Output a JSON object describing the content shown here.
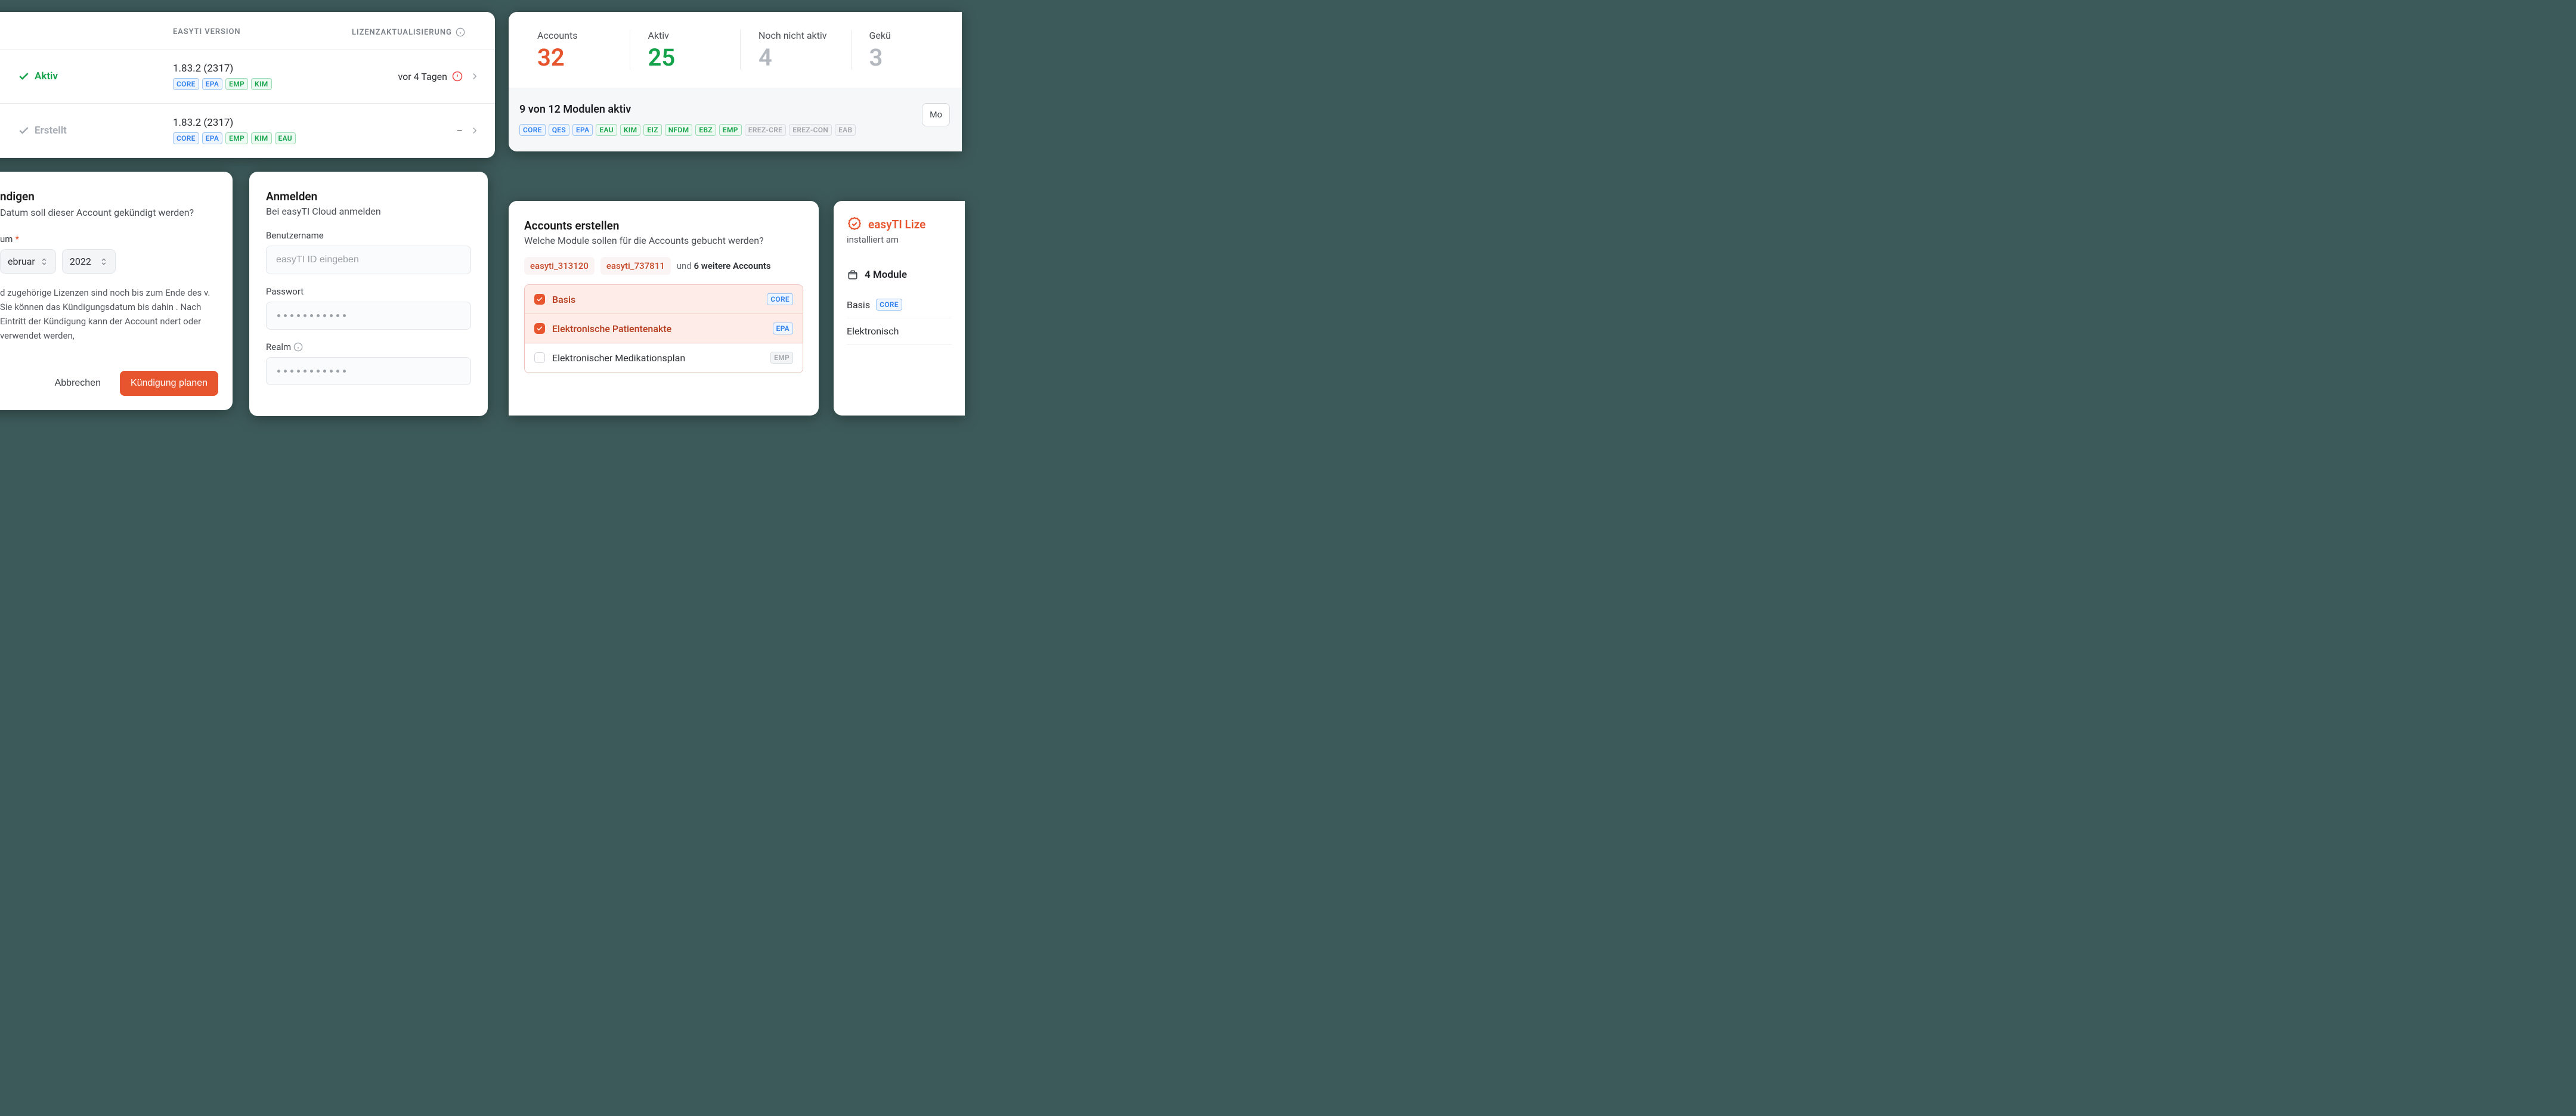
{
  "version_table": {
    "headers": {
      "version": "EASYTI VERSION",
      "license": "LIZENZAKTUALISIERUNG"
    },
    "rows": [
      {
        "status_label": "Aktiv",
        "status_state": "active",
        "version": "1.83.2 (2317)",
        "badges": [
          [
            "CORE",
            "blue"
          ],
          [
            "EPA",
            "blue"
          ],
          [
            "EMP",
            "green"
          ],
          [
            "KIM",
            "green"
          ]
        ],
        "license_text": "vor 4 Tagen",
        "license_warn": true,
        "license_dash": false
      },
      {
        "status_label": "Erstellt",
        "status_state": "idle",
        "version": "1.83.2 (2317)",
        "badges": [
          [
            "CORE",
            "blue"
          ],
          [
            "EPA",
            "blue"
          ],
          [
            "EMP",
            "green"
          ],
          [
            "KIM",
            "green"
          ],
          [
            "EAU",
            "green"
          ]
        ],
        "license_text": "–",
        "license_warn": false,
        "license_dash": true
      }
    ]
  },
  "stats": {
    "items": [
      {
        "label": "Accounts",
        "value": "32",
        "tone": "red"
      },
      {
        "label": "Aktiv",
        "value": "25",
        "tone": "green"
      },
      {
        "label": "Noch nicht aktiv",
        "value": "4",
        "tone": "gray"
      },
      {
        "label": "Gekü",
        "value": "3",
        "tone": "gray"
      }
    ],
    "modules_headline": "9 von 12 Modulen aktiv",
    "modules_button": "Mo",
    "modules": [
      [
        "CORE",
        "blue"
      ],
      [
        "QES",
        "blue"
      ],
      [
        "EPA",
        "blue"
      ],
      [
        "EAU",
        "green"
      ],
      [
        "KIM",
        "green"
      ],
      [
        "EIZ",
        "green"
      ],
      [
        "NFDM",
        "green"
      ],
      [
        "EBZ",
        "green"
      ],
      [
        "EMP",
        "green"
      ],
      [
        "EREZ-CRE",
        "off"
      ],
      [
        "EREZ-CON",
        "off"
      ],
      [
        "EAB",
        "off"
      ]
    ]
  },
  "cancel": {
    "title": "ndigen",
    "subtitle": "Datum soll dieser Account gekündigt werden?",
    "field_label": "um",
    "month": "ebruar",
    "year": "2022",
    "note": "d zugehörige Lizenzen sind noch bis zum Ende des v. Sie können das Kündigungsdatum bis dahin . Nach Eintritt der Kündigung kann der Account ndert oder verwendet werden,",
    "btn_cancel": "Abbrechen",
    "btn_confirm": "Kündigung planen"
  },
  "login": {
    "title": "Anmelden",
    "subtitle": "Bei easyTI Cloud anmelden",
    "user_label": "Benutzername",
    "user_placeholder": "easyTI ID eingeben",
    "pass_label": "Passwort",
    "realm_label": "Realm"
  },
  "create": {
    "title": "Accounts erstellen",
    "subtitle": "Welche Module sollen für die Accounts gebucht werden?",
    "chips": [
      "easyti_313120",
      "easyti_737811"
    ],
    "more_prefix": "und ",
    "more_count": "6 weitere Accounts",
    "modules": [
      {
        "selected": true,
        "label": "Basis",
        "badge": [
          "CORE",
          "blue"
        ]
      },
      {
        "selected": true,
        "label": "Elektronische Patientenakte",
        "badge": [
          "EPA",
          "blue"
        ]
      },
      {
        "selected": false,
        "label": "Elektronischer Medikationsplan",
        "badge": [
          "EMP",
          "off"
        ]
      }
    ]
  },
  "license": {
    "title": "easyTI Lize",
    "subtitle": "installiert am",
    "section_title": "4 Module",
    "items": [
      {
        "label": "Basis",
        "badge": [
          "CORE",
          "blue"
        ]
      },
      {
        "label": "Elektronisch",
        "badge": null
      }
    ]
  }
}
